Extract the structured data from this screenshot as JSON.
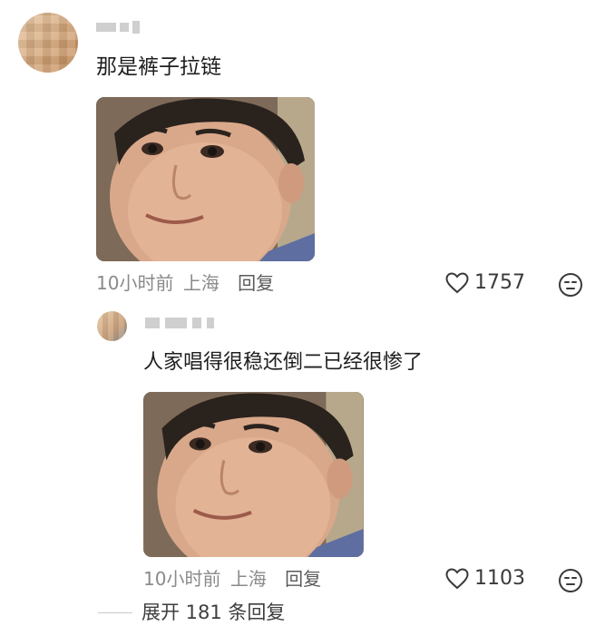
{
  "comment": {
    "author_name": "",
    "text": "那是裤子拉链",
    "time": "10小时前",
    "location": "上海",
    "reply_label": "回复",
    "likes": "1757",
    "image_icon": "meme-face-image",
    "emoji_icon": "emoji-reaction-icon"
  },
  "reply": {
    "author_name": "",
    "text": "人家唱得很稳还倒二已经很惨了",
    "time": "10小时前",
    "location": "上海",
    "reply_label": "回复",
    "likes": "1103",
    "image_icon": "meme-face-image",
    "emoji_icon": "emoji-reaction-icon"
  },
  "expand": {
    "label": "展开 181 条回复"
  },
  "colors": {
    "meta_gray": "#8a8a8a",
    "text_dark": "#1f1f1f",
    "divider": "#c9c9c9"
  }
}
